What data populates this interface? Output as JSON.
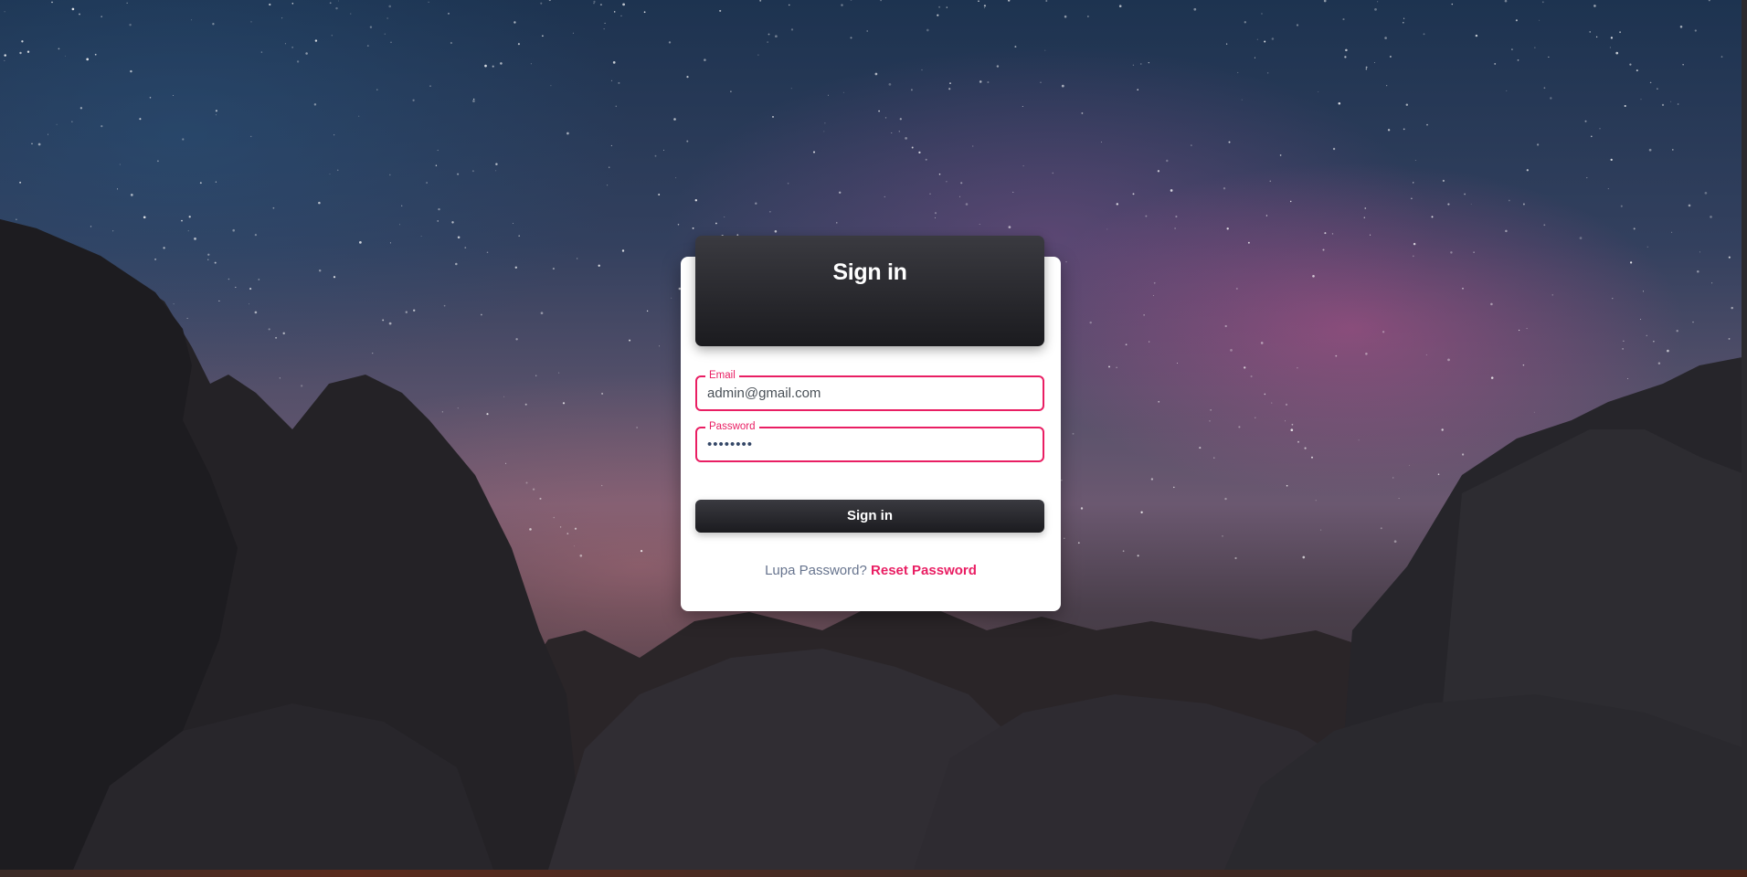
{
  "login": {
    "title": "Sign in",
    "email": {
      "label": "Email",
      "value": "admin@gmail.com"
    },
    "password": {
      "label": "Password",
      "masked_value": "••••••••"
    },
    "submit_label": "Sign in",
    "forgot": {
      "prompt": "Lupa Password?",
      "link_label": "Reset Password"
    }
  },
  "colors": {
    "accent": "#e91e63",
    "header_dark": "#1b1b1f",
    "card_bg": "#ffffff",
    "muted_text": "#67748e"
  },
  "background": {
    "scene": "starry-night-rocks-image"
  }
}
